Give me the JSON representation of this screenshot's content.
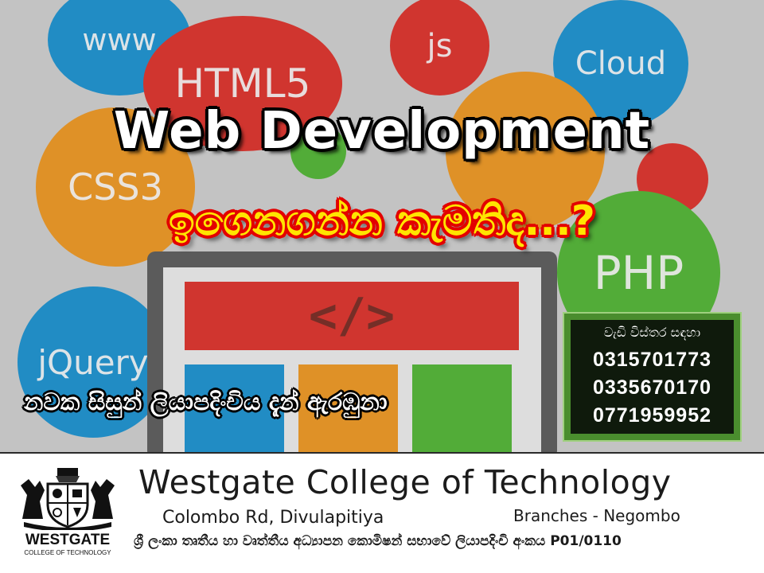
{
  "background": {
    "bubbles": [
      "www",
      "HTML5",
      "js",
      "Cloud",
      "CSS3",
      "PHP",
      "jQuery"
    ],
    "code_symbol": "</>"
  },
  "headline": "Web Development",
  "subheadline": "ඉගෙනගන්න කැමතිද...?",
  "registration": "නවක සිසුන් ලියාපදිංචිය දැන් ඇරඹුනා",
  "contact": {
    "title": "වැඩි විස්තර සඳහා",
    "phones": [
      "0315701773",
      "0335670170",
      "0771959952"
    ]
  },
  "footer": {
    "logo_name": "WESTGATE",
    "logo_sub": "COLLEGE OF TECHNOLOGY",
    "college_name": "Westgate College of Technology",
    "address": "Colombo Rd, Divulapitiya",
    "branches": "Branches - Negombo",
    "tvec_line": "ශ්‍රී ලංකා තෘතීය හා වෘත්තීය අධ්‍යාපන කොමිෂන් සභාවේ ලියාපදිංචි අංකය P01/0110"
  },
  "colors": {
    "headline_text": "#ffffff",
    "subheadline_text": "#ffe500",
    "subheadline_outline": "#e30000",
    "contact_border": "#4a8d2e"
  }
}
